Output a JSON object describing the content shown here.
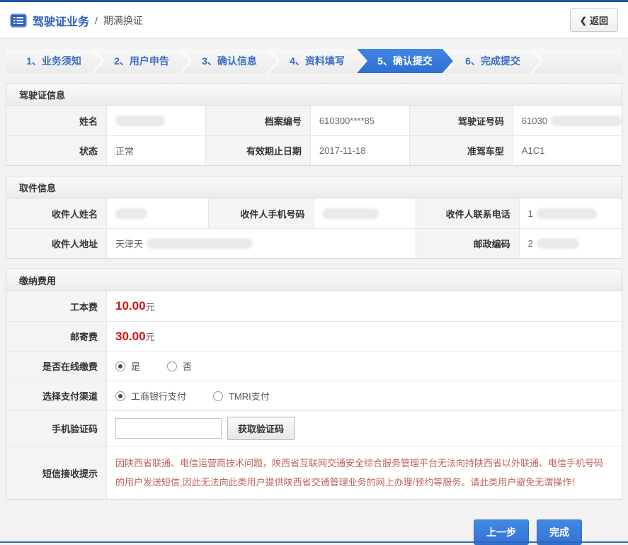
{
  "page": {
    "title_primary": "驾驶证业务",
    "title_separator": "/",
    "title_secondary": "期满换证",
    "back_icon": "❮",
    "back_button": "返回"
  },
  "steps": [
    {
      "label": "1、业务须知",
      "active": false
    },
    {
      "label": "2、用户申告",
      "active": false
    },
    {
      "label": "3、确认信息",
      "active": false
    },
    {
      "label": "4、资料填写",
      "active": false
    },
    {
      "label": "5、确认提交",
      "active": true
    },
    {
      "label": "6、完成提交",
      "active": false
    }
  ],
  "license_section": {
    "title": "驾驶证信息",
    "name_label": "姓名",
    "file_no_label": "档案编号",
    "file_no_value": "610300****85",
    "license_no_label": "驾驶证号码",
    "license_no_value": "61030",
    "status_label": "状态",
    "status_value": "正常",
    "valid_until_label": "有效期止日期",
    "valid_until_value": "2017-11-18",
    "vehicle_type_label": "准驾车型",
    "vehicle_type_value": "A1C1"
  },
  "pickup_section": {
    "title": "取件信息",
    "recipient_name_label": "收件人姓名",
    "recipient_mobile_label": "收件人手机号码",
    "recipient_phone_label": "收件人联系电话",
    "recipient_phone_value": "1",
    "recipient_address_label": "收件人地址",
    "recipient_address_value": "天津天",
    "postal_code_label": "邮政编码",
    "postal_code_value": "2"
  },
  "payment_section": {
    "title": "缴纳费用",
    "work_fee_label": "工本费",
    "work_fee_value": "10.00",
    "mail_fee_label": "邮寄费",
    "mail_fee_value": "30.00",
    "fee_unit": "元",
    "online_pay_label": "是否在线缴费",
    "online_pay_options": [
      {
        "label": "是",
        "selected": true
      },
      {
        "label": "否",
        "selected": false
      }
    ],
    "channel_label": "选择支付渠道",
    "channel_options": [
      {
        "label": "工商银行支付",
        "selected": true
      },
      {
        "label": "TMRI支付",
        "selected": false
      }
    ],
    "sms_code_label": "手机验证码",
    "sms_code_value": "",
    "get_code_button": "获取验证码",
    "sms_tip_label": "短信接收提示",
    "sms_tip_text": "因陕西省联通、电信运营商技术问题，陕西省互联网交通安全综合服务管理平台无法向持陕西省以外联通、电信手机号码的用户发送短信,因此无法向此类用户提供陕西省交通管理业务的网上办理/预约等服务。请此类用户避免无谓操作！"
  },
  "footer": {
    "prev_button": "上一步",
    "finish_button": "完成"
  },
  "colors": {
    "top_bar_blue": "#1e4fa1",
    "title_blue": "#2a5db5",
    "active_tab_blue": "#3579dd",
    "price_red": "#cf1515",
    "tip_red": "#bf625b",
    "button_blue": "#3a7edc"
  }
}
